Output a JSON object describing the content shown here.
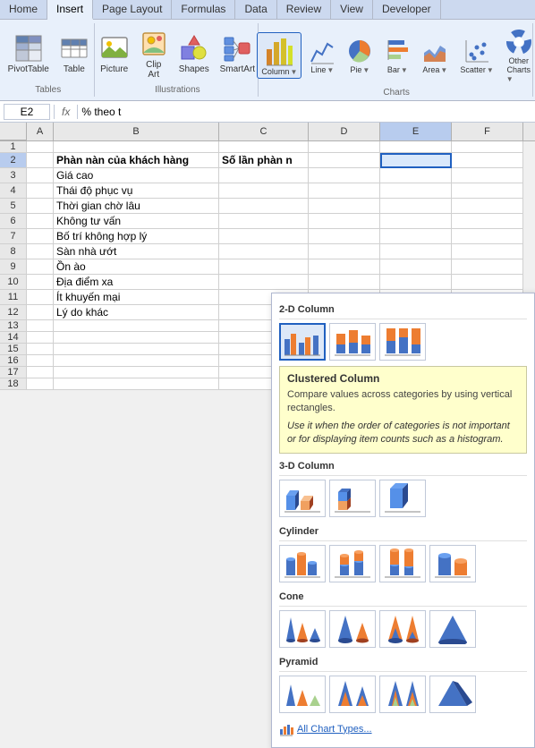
{
  "ribbon": {
    "tabs": [
      "Home",
      "Insert",
      "Page Layout",
      "Formulas",
      "Data",
      "Review",
      "View",
      "Developer"
    ],
    "active_tab": "Insert",
    "groups": {
      "tables": {
        "label": "Tables",
        "buttons": [
          {
            "id": "pivottable",
            "label": "PivotTable"
          },
          {
            "id": "table",
            "label": "Table"
          }
        ]
      },
      "illustrations": {
        "label": "Illustrations",
        "buttons": [
          {
            "id": "picture",
            "label": "Picture"
          },
          {
            "id": "clipart",
            "label": "Clip Art"
          },
          {
            "id": "shapes",
            "label": "Shapes"
          },
          {
            "id": "smartart",
            "label": "SmartArt"
          }
        ]
      },
      "charts": {
        "label": "Charts",
        "buttons": [
          {
            "id": "column",
            "label": "Column",
            "active": true
          },
          {
            "id": "line",
            "label": "Line"
          },
          {
            "id": "pie",
            "label": "Pie"
          },
          {
            "id": "bar",
            "label": "Bar"
          },
          {
            "id": "area",
            "label": "Area"
          },
          {
            "id": "scatter",
            "label": "Scatter"
          },
          {
            "id": "other",
            "label": "Other\nCharts"
          }
        ]
      }
    }
  },
  "formula_bar": {
    "cell_ref": "E2",
    "formula": "% theo t"
  },
  "columns": [
    "A",
    "B",
    "C",
    "D",
    "E",
    "F"
  ],
  "rows": [
    {
      "num": 1,
      "cells": [
        "",
        "",
        "",
        "",
        "",
        ""
      ]
    },
    {
      "num": 2,
      "cells": [
        "",
        "Phàn nàn của khách hàng",
        "Số lần phàn n",
        "",
        "",
        ""
      ]
    },
    {
      "num": 3,
      "cells": [
        "",
        "Giá cao",
        "",
        "",
        "",
        ""
      ]
    },
    {
      "num": 4,
      "cells": [
        "",
        "Thái độ phục vụ",
        "",
        "",
        "",
        ""
      ]
    },
    {
      "num": 5,
      "cells": [
        "",
        "Thời gian chờ lâu",
        "",
        "",
        "",
        ""
      ]
    },
    {
      "num": 6,
      "cells": [
        "",
        "Không tư vấn",
        "",
        "",
        "",
        ""
      ]
    },
    {
      "num": 7,
      "cells": [
        "",
        "Bố trí không hợp lý",
        "",
        "",
        "",
        ""
      ]
    },
    {
      "num": 8,
      "cells": [
        "",
        "Sàn nhà ướt",
        "",
        "",
        "",
        ""
      ]
    },
    {
      "num": 9,
      "cells": [
        "",
        "Ồn ào",
        "",
        "",
        "",
        ""
      ]
    },
    {
      "num": 10,
      "cells": [
        "",
        "Địa điểm xa",
        "",
        "",
        "",
        ""
      ]
    },
    {
      "num": 11,
      "cells": [
        "",
        "Ít khuyến mại",
        "",
        "",
        "",
        ""
      ]
    },
    {
      "num": 12,
      "cells": [
        "",
        "Lý do khác",
        "",
        "",
        "",
        ""
      ]
    },
    {
      "num": 13,
      "cells": [
        "",
        "",
        "",
        "",
        "",
        ""
      ]
    },
    {
      "num": 14,
      "cells": [
        "",
        "",
        "",
        "",
        "",
        ""
      ]
    },
    {
      "num": 15,
      "cells": [
        "",
        "",
        "",
        "",
        "",
        ""
      ]
    },
    {
      "num": 16,
      "cells": [
        "",
        "",
        "",
        "",
        "",
        ""
      ]
    },
    {
      "num": 17,
      "cells": [
        "",
        "",
        "",
        "",
        "",
        ""
      ]
    },
    {
      "num": 18,
      "cells": [
        "",
        "",
        "",
        "",
        "",
        ""
      ]
    }
  ],
  "dropdown": {
    "sections": [
      {
        "id": "2d-column",
        "title": "2-D Column",
        "charts": [
          {
            "id": "clustered-col",
            "selected": true
          },
          {
            "id": "stacked-col"
          },
          {
            "id": "100-stacked-col"
          }
        ]
      },
      {
        "id": "3d-column",
        "title": "3-D Column",
        "charts": [
          {
            "id": "3d-clustered-col"
          },
          {
            "id": "3d-stacked-col"
          },
          {
            "id": "3d-col"
          }
        ]
      },
      {
        "id": "cylinder",
        "title": "Cylinder",
        "charts": [
          {
            "id": "cyl-clustered"
          },
          {
            "id": "cyl-stacked"
          },
          {
            "id": "cyl-100"
          },
          {
            "id": "cyl-3d"
          }
        ]
      },
      {
        "id": "cone",
        "title": "Cone",
        "charts": [
          {
            "id": "cone-clustered"
          },
          {
            "id": "cone-stacked"
          },
          {
            "id": "cone-100"
          },
          {
            "id": "cone-3d"
          }
        ]
      },
      {
        "id": "pyramid",
        "title": "Pyramid",
        "charts": [
          {
            "id": "pyr-clustered"
          },
          {
            "id": "pyr-stacked"
          },
          {
            "id": "pyr-100"
          },
          {
            "id": "pyr-3d"
          }
        ]
      }
    ],
    "tooltip": {
      "title": "Clustered Column",
      "text1": "Compare values across categories by using vertical rectangles.",
      "text2": "Use it when the order of categories is not important or for displaying item counts such as a histogram."
    },
    "all_chart_types": "All Chart Types..."
  }
}
